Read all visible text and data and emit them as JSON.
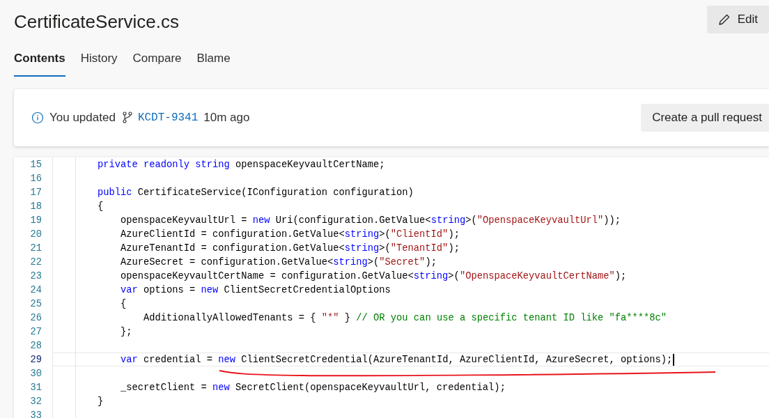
{
  "file": {
    "title": "CertificateService.cs",
    "edit_button": "Edit"
  },
  "tabs": [
    {
      "label": "Contents",
      "selected": true
    },
    {
      "label": "History",
      "selected": false
    },
    {
      "label": "Compare",
      "selected": false
    },
    {
      "label": "Blame",
      "selected": false
    }
  ],
  "banner": {
    "prefix": "You updated",
    "branch": "KCDT-9341",
    "suffix": "10m ago",
    "button": "Create a pull request"
  },
  "code": {
    "lines": [
      {
        "number": "15",
        "current": false,
        "tokens": [
          {
            "kind": "keyword",
            "text": "        private readonly string"
          },
          {
            "kind": "plain",
            "text": " openspaceKeyvaultCertName;"
          }
        ]
      },
      {
        "number": "16",
        "current": false
      },
      {
        "number": "17",
        "current": false,
        "tokens": [
          {
            "kind": "keyword",
            "text": "        public"
          },
          {
            "kind": "plain",
            "text": " CertificateService(IConfiguration configuration)"
          }
        ]
      },
      {
        "number": "18",
        "current": false,
        "tokens": [
          {
            "kind": "plain",
            "text": "        {"
          }
        ]
      },
      {
        "number": "19",
        "current": false,
        "tokens": [
          {
            "kind": "plain",
            "text": "            openspaceKeyvaultUrl = "
          },
          {
            "kind": "keyword",
            "text": "new"
          },
          {
            "kind": "plain",
            "text": " Uri(configuration.GetValue<"
          },
          {
            "kind": "keyword",
            "text": "string"
          },
          {
            "kind": "plain",
            "text": ">("
          },
          {
            "kind": "string",
            "text": "\"OpenspaceKeyvaultUrl\""
          },
          {
            "kind": "plain",
            "text": "));"
          }
        ]
      },
      {
        "number": "20",
        "current": false,
        "tokens": [
          {
            "kind": "plain",
            "text": "            AzureClientId = configuration.GetValue<"
          },
          {
            "kind": "keyword",
            "text": "string"
          },
          {
            "kind": "plain",
            "text": ">("
          },
          {
            "kind": "string",
            "text": "\"ClientId\""
          },
          {
            "kind": "plain",
            "text": ");"
          }
        ]
      },
      {
        "number": "21",
        "current": false,
        "tokens": [
          {
            "kind": "plain",
            "text": "            AzureTenantId = configuration.GetValue<"
          },
          {
            "kind": "keyword",
            "text": "string"
          },
          {
            "kind": "plain",
            "text": ">("
          },
          {
            "kind": "string",
            "text": "\"TenantId\""
          },
          {
            "kind": "plain",
            "text": ");"
          }
        ]
      },
      {
        "number": "22",
        "current": false,
        "tokens": [
          {
            "kind": "plain",
            "text": "            AzureSecret = configuration.GetValue<"
          },
          {
            "kind": "keyword",
            "text": "string"
          },
          {
            "kind": "plain",
            "text": ">("
          },
          {
            "kind": "string",
            "text": "\"Secret\""
          },
          {
            "kind": "plain",
            "text": ");"
          }
        ]
      },
      {
        "number": "23",
        "current": false,
        "tokens": [
          {
            "kind": "plain",
            "text": "            openspaceKeyvaultCertName = configuration.GetValue<"
          },
          {
            "kind": "keyword",
            "text": "string"
          },
          {
            "kind": "plain",
            "text": ">("
          },
          {
            "kind": "string",
            "text": "\"OpenspaceKeyvaultCertName\""
          },
          {
            "kind": "plain",
            "text": ");"
          }
        ]
      },
      {
        "number": "24",
        "current": false,
        "tokens": [
          {
            "kind": "keyword",
            "text": "            var"
          },
          {
            "kind": "plain",
            "text": " options = "
          },
          {
            "kind": "keyword",
            "text": "new"
          },
          {
            "kind": "plain",
            "text": " ClientSecretCredentialOptions"
          }
        ]
      },
      {
        "number": "25",
        "current": false,
        "tokens": [
          {
            "kind": "plain",
            "text": "            {"
          }
        ]
      },
      {
        "number": "26",
        "current": false,
        "tokens": [
          {
            "kind": "plain",
            "text": "                AdditionallyAllowedTenants = { "
          },
          {
            "kind": "string",
            "text": "\"*\""
          },
          {
            "kind": "plain",
            "text": " } "
          },
          {
            "kind": "comment",
            "text": "// OR you can use a specific tenant ID like \"fa****8c\""
          }
        ]
      },
      {
        "number": "27",
        "current": false,
        "tokens": [
          {
            "kind": "plain",
            "text": "            };"
          }
        ]
      },
      {
        "number": "28",
        "current": false
      },
      {
        "number": "29",
        "current": true,
        "tokens": [
          {
            "kind": "keyword",
            "text": "            var"
          },
          {
            "kind": "plain",
            "text": " credential = "
          },
          {
            "kind": "keyword",
            "text": "new"
          },
          {
            "kind": "plain",
            "text": " ClientSecretCredential(AzureTenantId, AzureClientId, AzureSecret, options);"
          }
        ]
      },
      {
        "number": "30",
        "current": false
      },
      {
        "number": "31",
        "current": false,
        "tokens": [
          {
            "kind": "plain",
            "text": "            _secretClient = "
          },
          {
            "kind": "keyword",
            "text": "new"
          },
          {
            "kind": "plain",
            "text": " SecretClient(openspaceKeyvaultUrl, credential);"
          }
        ]
      },
      {
        "number": "32",
        "current": false,
        "tokens": [
          {
            "kind": "plain",
            "text": "        }"
          }
        ]
      },
      {
        "number": "33",
        "current": false
      }
    ]
  }
}
